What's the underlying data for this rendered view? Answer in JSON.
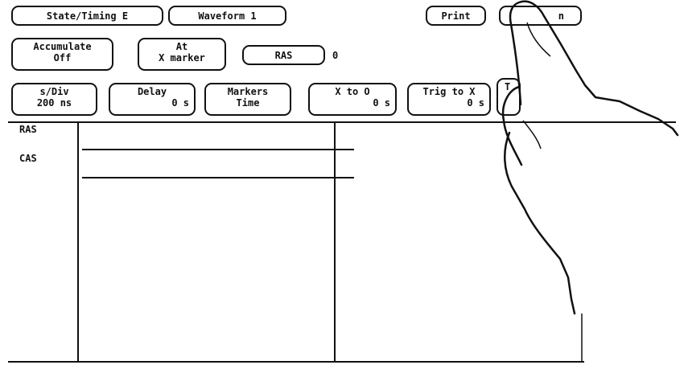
{
  "menu": {
    "module": "State/Timing E",
    "view": "Waveform 1",
    "print": "Print",
    "run": "n"
  },
  "controls": {
    "accumulate_line1": "Accumulate",
    "accumulate_line2": "Off",
    "at_line1": "At",
    "at_line2": "X marker",
    "signal_select": "RAS",
    "signal_value": "0"
  },
  "fields": {
    "sdiv_label": "s/Div",
    "sdiv_value": "200 ns",
    "delay_label": "Delay",
    "delay_value": "0  s",
    "markers_label": "Markers",
    "markers_value": "Time",
    "xtoo_label": "X to O",
    "xtoo_value": "0  s",
    "trigtox_label": "Trig to X",
    "trigtox_value": "0  s",
    "partial_label": "T"
  },
  "waveform": {
    "labels": [
      "RAS",
      "CAS"
    ]
  },
  "colors": {
    "ink": "#111111",
    "background": "#ffffff"
  },
  "icons": {
    "hand": "pointing-hand-icon"
  }
}
